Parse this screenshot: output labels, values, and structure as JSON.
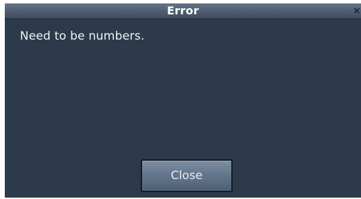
{
  "dialog": {
    "title": "Error",
    "close_icon": "×",
    "message": "Need to be numbers.",
    "close_button_label": "Close"
  },
  "colors": {
    "dialog_background": "#2c3a4c",
    "titlebar": "#4e5e70",
    "button": "#64778c",
    "text": "#ffffff"
  },
  "icons": {
    "close": "close-icon"
  }
}
